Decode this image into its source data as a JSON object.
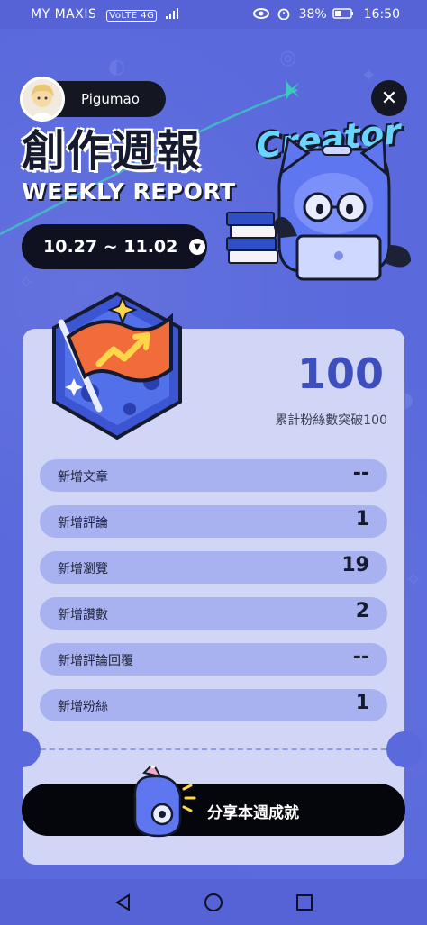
{
  "status_bar": {
    "carrier": "MY MAXIS",
    "network": "VoLTE 4G",
    "battery": "38%",
    "time": "16:50"
  },
  "header": {
    "username": "Pigumao",
    "title_zh": "創作週報",
    "title_en": "WEEKLY REPORT",
    "creator_label": "Creator",
    "date_range": "10.27 ~ 11.02"
  },
  "highlight": {
    "value": "100",
    "label": "累計粉絲數突破100"
  },
  "stats": [
    {
      "label": "新增文章",
      "value": "--"
    },
    {
      "label": "新增評論",
      "value": "1"
    },
    {
      "label": "新增瀏覽",
      "value": "19"
    },
    {
      "label": "新增讚數",
      "value": "2"
    },
    {
      "label": "新增評論回覆",
      "value": "--"
    },
    {
      "label": "新增粉絲",
      "value": "1"
    }
  ],
  "share": {
    "label": "分享本週成就"
  },
  "colors": {
    "background": "#5a69dc",
    "card": "#d1d6f7",
    "row": "#a8b2f0",
    "accent_number": "#3d4fbf",
    "dark": "#0f1120",
    "badge_orange": "#f26b3a",
    "badge_blue": "#3c55d3"
  },
  "icons": {
    "close": "close-icon",
    "date_toggle": "chevron-down-icon",
    "back": "back-icon",
    "home": "home-icon",
    "recent": "recent-apps-icon"
  }
}
